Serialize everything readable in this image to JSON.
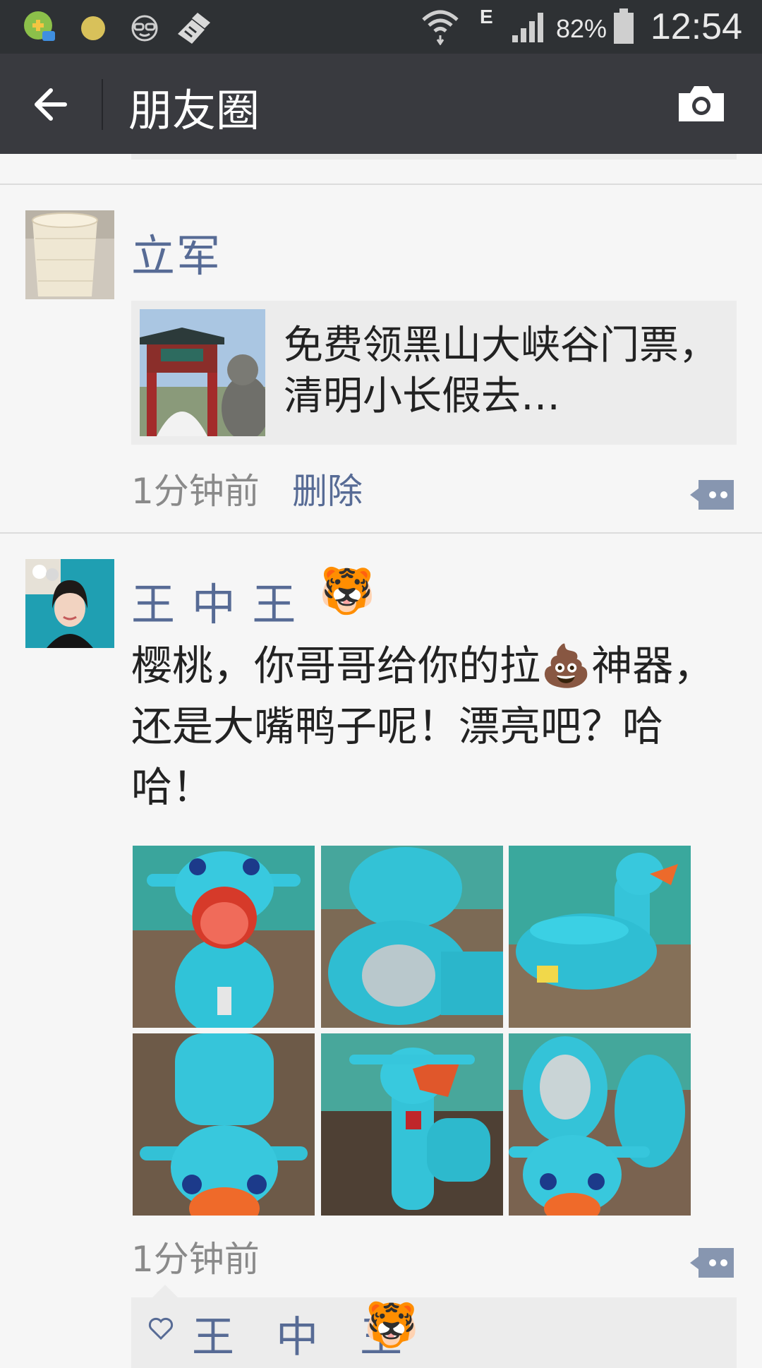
{
  "status_bar": {
    "network": "E",
    "battery": "82%",
    "time": "12:54"
  },
  "nav": {
    "title": "朋友圈"
  },
  "posts": [
    {
      "author": "立军",
      "share_title": "免费领黑山大峡谷门票，清明小长假去…",
      "time": "1分钟前",
      "delete": "删除"
    },
    {
      "author": "王 中 王",
      "author_emoji": "🐯",
      "text": "樱桃，你哥哥给你的拉💩神器，还是大嘴鸭子呢！漂亮吧？哈哈！",
      "time": "1分钟前",
      "likes": "王 中 王",
      "likes_emoji": "🐯"
    }
  ],
  "colors": {
    "status_bar": "#2e3134",
    "nav_bar": "#393a3f",
    "name_link": "#576b95",
    "background": "#f6f6f6"
  }
}
